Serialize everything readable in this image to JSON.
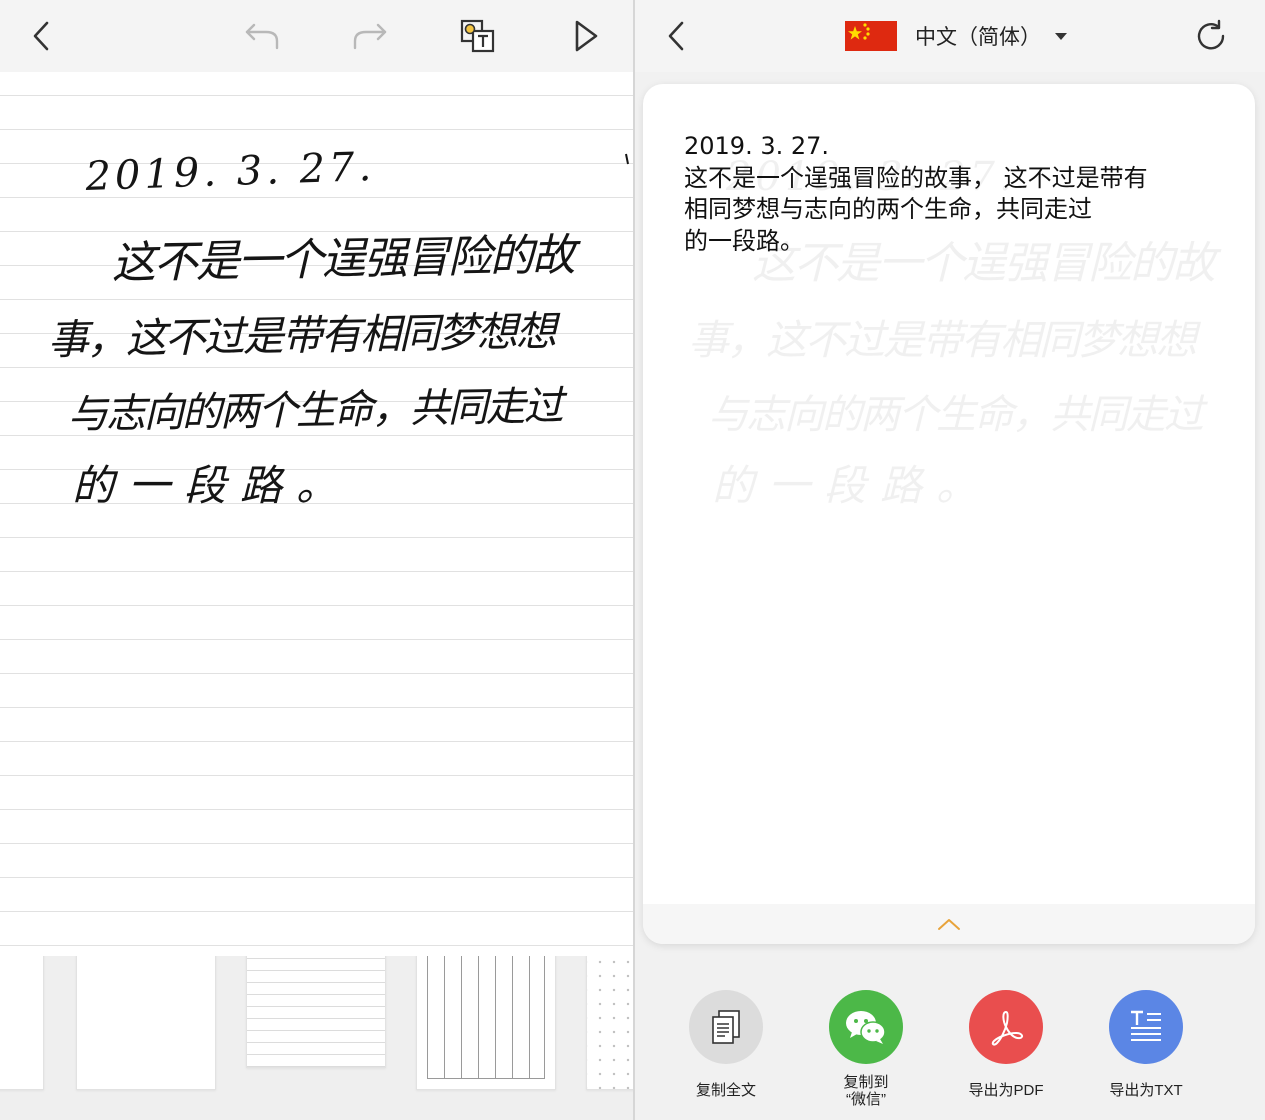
{
  "left_toolbar": {
    "icons": [
      "back-icon",
      "undo-icon",
      "redo-icon",
      "ocr-recognize-icon",
      "play-icon"
    ]
  },
  "handwriting": {
    "lines": [
      "2019. 3. 27.",
      "这不是一个逞强冒险的故",
      "事，这不过是带有相同梦想想",
      "与志向的两个生命，共同走过",
      "的一段路。"
    ]
  },
  "templates": [
    "blank-template",
    "lined-template",
    "grid-template",
    "dotted-template"
  ],
  "right_toolbar": {
    "language": "中文（简体）",
    "icons": [
      "back-icon",
      "china-flag-icon",
      "dropdown-caret-icon",
      "refresh-icon"
    ]
  },
  "ocr_result": {
    "text": "2019. 3. 27.\n这不是一个逞强冒险的故事， 这不过是带有\n相同梦想与志向的两个生命，共同走过\n的一段路。"
  },
  "actions": [
    {
      "label": "复制全文",
      "color": "#dcdcdc",
      "icon": "copy-document-icon"
    },
    {
      "label": "复制到\n“微信”",
      "color": "#4cb848",
      "icon": "wechat-icon"
    },
    {
      "label": "导出为PDF",
      "color": "#e94e4e",
      "icon": "pdf-icon"
    },
    {
      "label": "导出为TXT",
      "color": "#5b86e5",
      "icon": "txt-document-icon"
    }
  ],
  "colors": {
    "toolbar_bg": "#f4f4f4",
    "accent_caret": "#e8a33a",
    "flag_red": "#de2910",
    "flag_yellow": "#ffde00"
  }
}
